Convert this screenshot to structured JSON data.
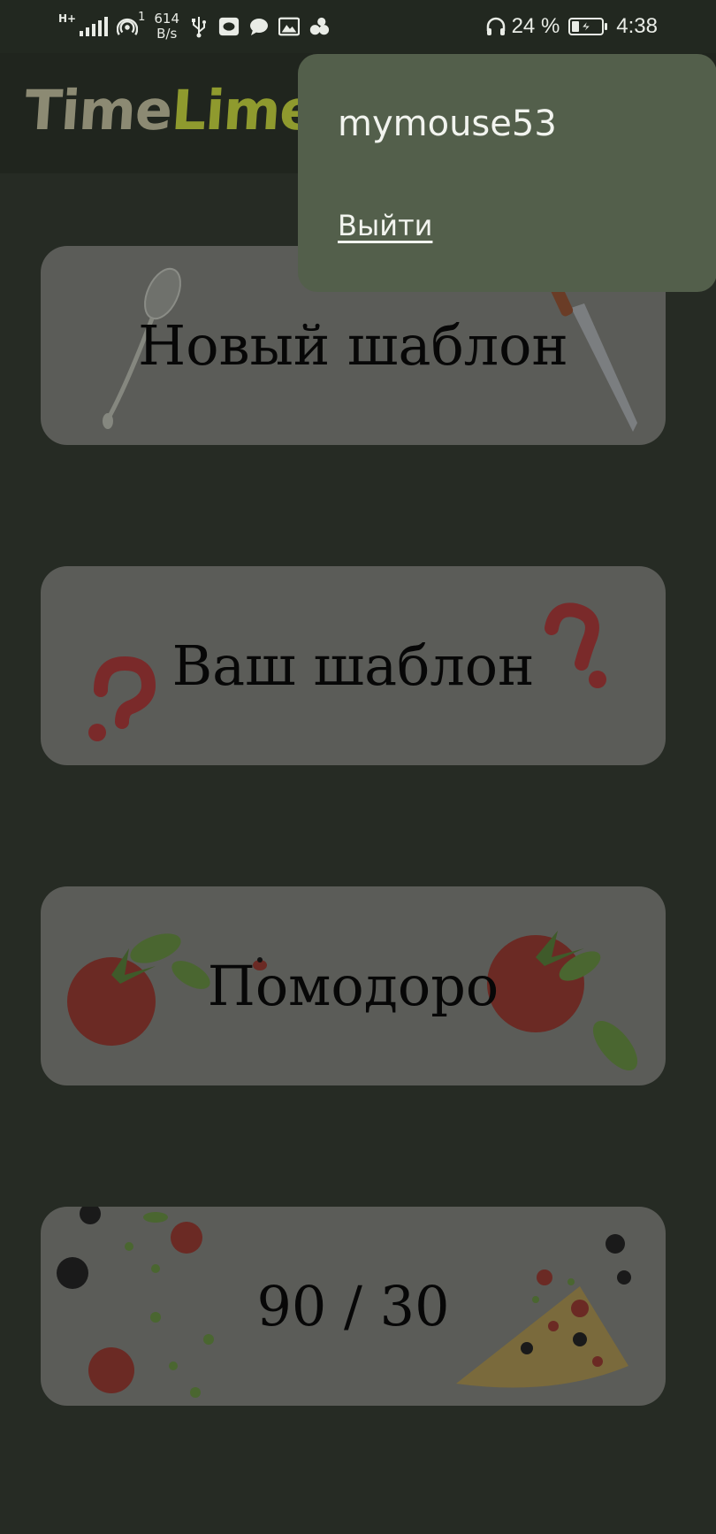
{
  "status_bar": {
    "network_type": "H+",
    "sim_index": "1",
    "net_speed_value": "614",
    "net_speed_unit": "B/s",
    "battery_percent": "24 %",
    "battery_level": 0.24,
    "time": "4:38"
  },
  "app": {
    "logo_part1": "Time",
    "logo_part2": "Lime"
  },
  "menu": {
    "username": "mymouse53",
    "logout_label": "Выйти"
  },
  "cards": [
    {
      "label": "Новый шаблон"
    },
    {
      "label": "Ваш шаблон"
    },
    {
      "label": "Помодоро"
    },
    {
      "label": "90 / 30"
    }
  ],
  "colors": {
    "background": "#262b24",
    "app_bar": "#20251e",
    "card": "#5b5c58",
    "popup": "#535f4b",
    "logo_time": "#8c8a73",
    "logo_lime": "#8f9a2e"
  }
}
